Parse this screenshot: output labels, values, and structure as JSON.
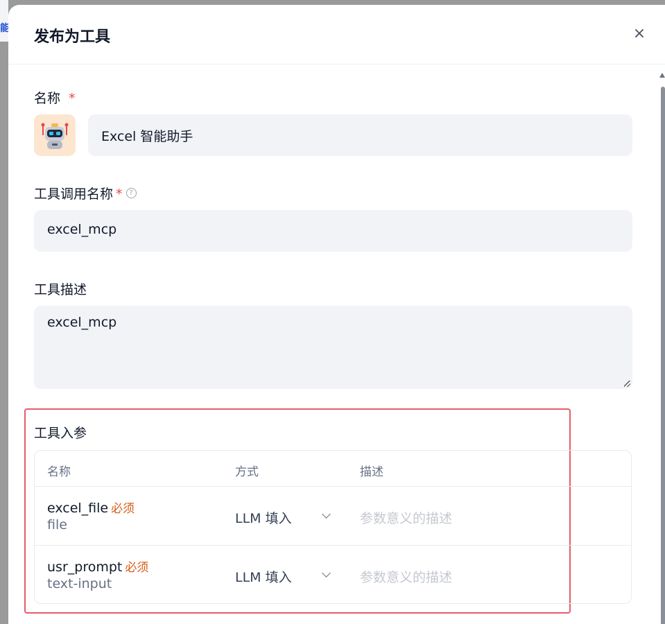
{
  "background": {
    "glyph": "能"
  },
  "modal": {
    "title": "发布为工具",
    "close_icon": "×"
  },
  "fields": {
    "name": {
      "label": "名称",
      "required_mark": "*",
      "value": "Excel 智能助手",
      "avatar_icon": "robot-icon"
    },
    "call_name": {
      "label": "工具调用名称",
      "required_mark": "*",
      "help_icon": "?",
      "value": "excel_mcp"
    },
    "description": {
      "label": "工具描述",
      "value": "excel_mcp"
    }
  },
  "params": {
    "section_label": "工具入参",
    "headers": {
      "name": "名称",
      "method": "方式",
      "desc": "描述"
    },
    "rows": [
      {
        "name": "excel_file",
        "required": "必须",
        "type": "file",
        "method": "LLM 填入",
        "desc_placeholder": "参数意义的描述"
      },
      {
        "name": "usr_prompt",
        "required": "必须",
        "type": "text-input",
        "method": "LLM 填入",
        "desc_placeholder": "参数意义的描述"
      }
    ]
  },
  "colors": {
    "required": "#e5484d",
    "required_tag": "#d65b1a",
    "highlight_border": "#e35d6a",
    "input_bg": "#f2f3f7"
  }
}
